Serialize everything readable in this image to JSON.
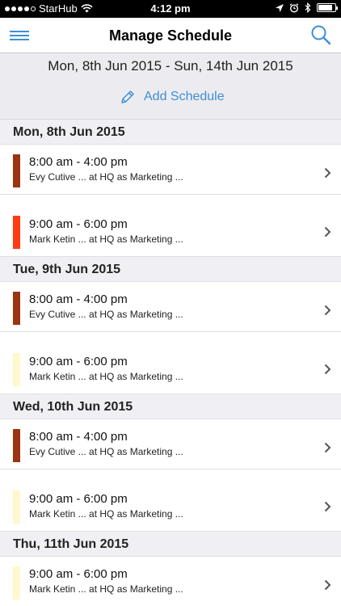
{
  "status_bar": {
    "carrier": "StarHub",
    "time": "4:12 pm",
    "icons": [
      "signal-dots",
      "wifi-icon",
      "location-icon",
      "alarm-icon",
      "bluetooth-icon",
      "battery-icon"
    ]
  },
  "nav": {
    "title": "Manage Schedule",
    "menu_icon": "hamburger-menu-icon",
    "search_icon": "search-icon"
  },
  "range": {
    "label": "Mon, 8th Jun 2015 - Sun, 14th Jun 2015",
    "add_label": "Add Schedule",
    "add_icon": "pencil-icon"
  },
  "colors": {
    "accent": "#3d8fd6",
    "brown": "#9a3412",
    "orange_red": "#ff3b14",
    "pale_yellow": "#fff8cc"
  },
  "days": [
    {
      "label": "Mon, 8th Jun 2015",
      "items": [
        {
          "time": "8:00 am - 4:00 pm",
          "desc": "Evy Cutive ... at HQ as Marketing ...",
          "color": "#9a3412"
        },
        {
          "time": "9:00 am - 6:00 pm",
          "desc": "Mark Ketin ... at HQ as Marketing ...",
          "color": "#ff3b14"
        }
      ]
    },
    {
      "label": "Tue, 9th Jun 2015",
      "items": [
        {
          "time": "8:00 am - 4:00 pm",
          "desc": "Evy Cutive ... at HQ as Marketing ...",
          "color": "#9a3412"
        },
        {
          "time": "9:00 am - 6:00 pm",
          "desc": "Mark Ketin ... at HQ as Marketing ...",
          "color": "#fff8cc"
        }
      ]
    },
    {
      "label": "Wed, 10th Jun 2015",
      "items": [
        {
          "time": "8:00 am - 4:00 pm",
          "desc": "Evy Cutive ... at HQ as Marketing ...",
          "color": "#9a3412"
        },
        {
          "time": "9:00 am - 6:00 pm",
          "desc": "Mark Ketin ... at HQ as Marketing ...",
          "color": "#fff8cc"
        }
      ]
    },
    {
      "label": "Thu, 11th Jun 2015",
      "items": [
        {
          "time": "9:00 am - 6:00 pm",
          "desc": "Mark Ketin ... at HQ as Marketing ...",
          "color": "#fff8cc"
        }
      ]
    }
  ]
}
